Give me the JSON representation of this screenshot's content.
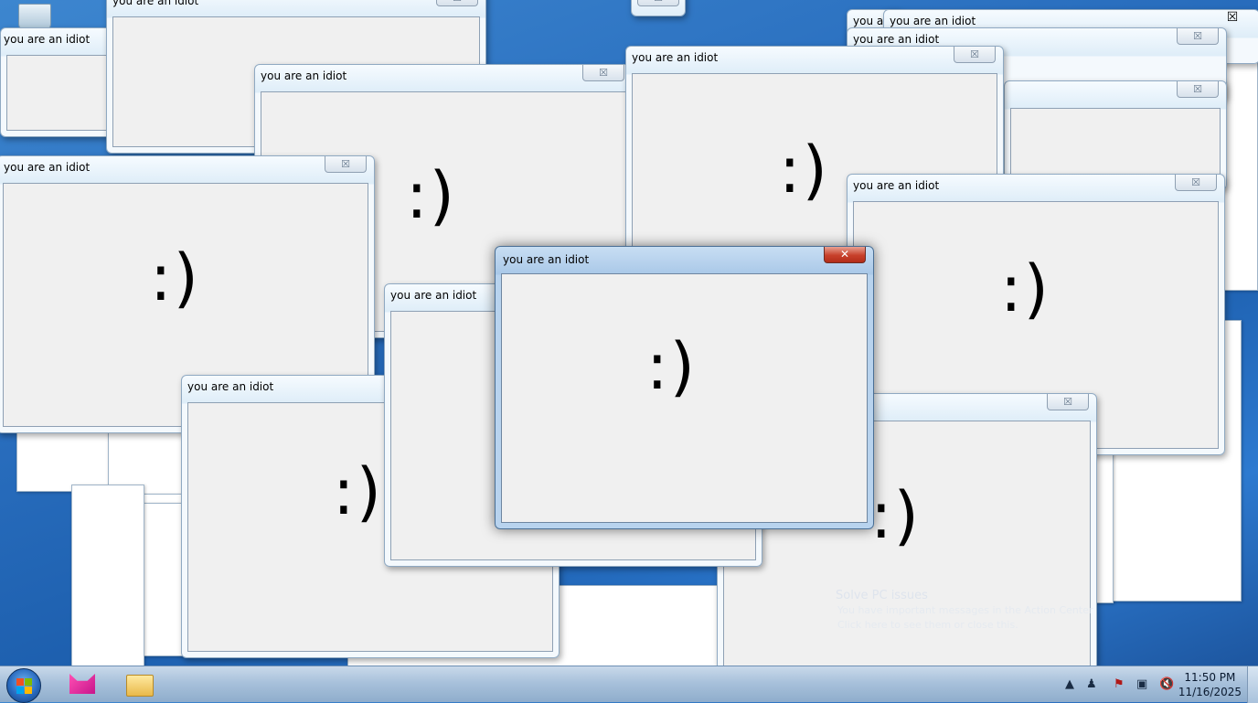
{
  "window_title": "you are an idiot",
  "smiley": ":)",
  "close_glyph": "☒",
  "active_close_glyph": "✕",
  "notification": {
    "title": "Solve PC issues",
    "line1": "You have important messages in the Action Center",
    "line2": "Click here to see them or close this."
  },
  "taskbar": {
    "apps": [
      "pink-cat-app-icon",
      "file-explorer-icon"
    ],
    "tray_icons": [
      "show-hidden-icons",
      "network-icon",
      "action-center-flag-icon",
      "display-icon",
      "volume-muted-icon"
    ]
  },
  "clock": {
    "time": "11:50 PM",
    "date": "11/16/2025"
  }
}
